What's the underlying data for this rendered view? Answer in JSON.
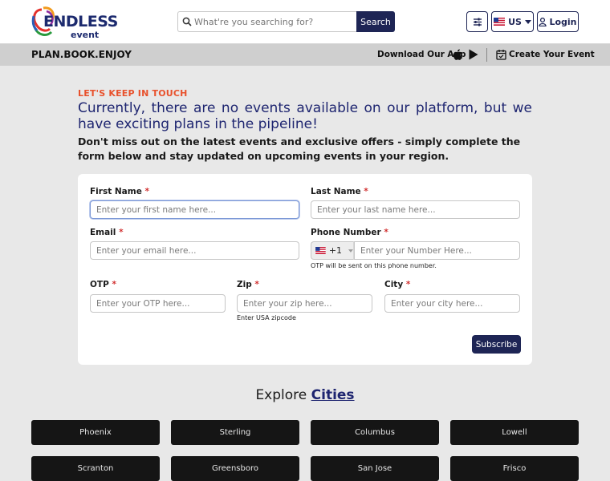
{
  "header": {
    "logo_text": "ENDLESS",
    "logo_sub": "event",
    "search": {
      "placeholder": "What're you searching for?",
      "button_label": "Search"
    },
    "country_label": "US",
    "login_label": "Login"
  },
  "subbar": {
    "tagline": "PLAN.BOOK.ENJOY",
    "download_label": "Download Our App",
    "create_event_label": "Create Your Event"
  },
  "hero": {
    "kicker": "LET'S KEEP IN TOUCH",
    "headline": "Currently, there are no events available on our platform, but we have exciting plans in the pipeline!",
    "subline": "Don't miss out on the latest events and exclusive offers - simply complete the form below and stay updated on upcoming events in your region."
  },
  "form": {
    "required_mark": "*",
    "first_name": {
      "label": "First Name",
      "placeholder": "Enter your first name here..."
    },
    "last_name": {
      "label": "Last Name",
      "placeholder": "Enter your last name here..."
    },
    "email": {
      "label": "Email",
      "placeholder": "Enter your email here..."
    },
    "phone": {
      "label": "Phone Number",
      "dial_code": "+1",
      "placeholder": "Enter your Number Here...",
      "hint": "OTP will be sent on this phone number."
    },
    "otp": {
      "label": "OTP",
      "placeholder": "Enter your OTP here..."
    },
    "zip": {
      "label": "Zip",
      "placeholder": "Enter your zip here...",
      "hint": "Enter USA zipcode"
    },
    "city": {
      "label": "City",
      "placeholder": "Enter your city here..."
    },
    "subscribe_label": "Subscribe"
  },
  "explore": {
    "prefix": "Explore",
    "link": "Cities"
  },
  "cities": [
    "Phoenix",
    "Sterling",
    "Columbus",
    "Lowell",
    "Scranton",
    "Greensboro",
    "San Jose",
    "Frisco"
  ],
  "colors": {
    "brand_navy": "#1e2555",
    "headline_blue": "#1e2570",
    "kicker_orange": "#e8512c",
    "required_red": "#d12f2f",
    "city_tile": "#151515"
  },
  "icons": [
    "search-icon",
    "filter-icon",
    "us-flag-icon",
    "caret-down-icon",
    "user-icon",
    "apple-icon",
    "play-store-icon",
    "calendar-check-icon"
  ]
}
